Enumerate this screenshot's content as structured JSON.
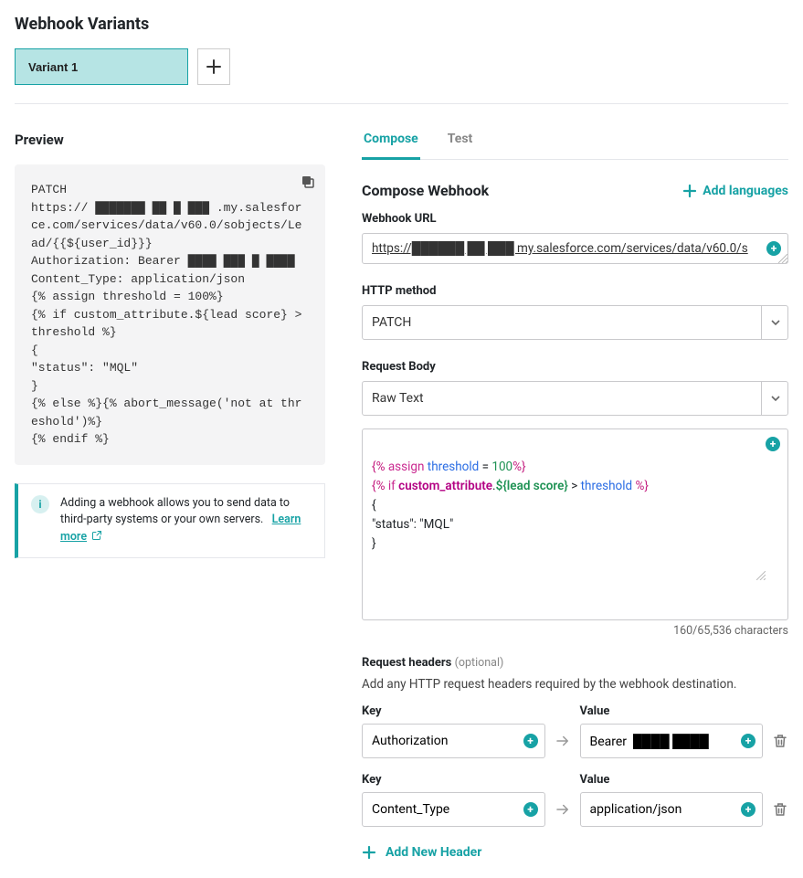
{
  "page_title": "Webhook Variants",
  "variant_tab": "Variant 1",
  "preview_label": "Preview",
  "preview_text": "PATCH\nhttps:// ███████ ██ █ ███ .my.salesforce.com/services/data/v60.0/sobjects/Lead/{{${user_id}}}\nAuthorization: Bearer ████ ███ █ ████\nContent_Type: application/json\n{% assign threshold = 100%}\n{% if custom_attribute.${lead score} > threshold %}\n{\n\"status\": \"MQL\"\n}\n{% else %}{% abort_message('not at threshold')%}\n{% endif %}",
  "info_text": "Adding a webhook allows you to send data to third-party systems or your own servers.",
  "learn_more": "Learn more",
  "tabs": {
    "compose": "Compose",
    "test": "Test"
  },
  "compose_title": "Compose Webhook",
  "add_languages": "Add languages",
  "url_label": "Webhook URL",
  "url_value": "https://██████ ██ ███ my.salesforce.com/services/data/v60.0/s",
  "method_label": "HTTP method",
  "method_value": "PATCH",
  "body_label": "Request Body",
  "body_type_value": "Raw Text",
  "body_code": {
    "line1_pre": "{% ",
    "line1_assign": "assign",
    "line1_mid1": " ",
    "line1_threshold": "threshold",
    "line1_mid2": " = ",
    "line1_num": "100",
    "line1_post": "%}",
    "line2_pre": "{% ",
    "line2_if": "if",
    "line2_mid1": " ",
    "line2_attr": "custom_attribute",
    "line2_dot": ".",
    "line2_param": "${lead score}",
    "line2_gt": " > ",
    "line2_thresh": "threshold",
    "line2_sp": " ",
    "line2_post": "%}",
    "line3": "{",
    "line4": "\"status\": \"MQL\"",
    "line5": "}"
  },
  "char_count": "160/65,536 characters",
  "req_headers_label": "Request headers",
  "optional_text": "(optional)",
  "req_headers_sub": "Add any HTTP request headers required by the webhook destination.",
  "key_label": "Key",
  "value_label": "Value",
  "headers": [
    {
      "key": "Authorization",
      "value": "Bearer  ████ ████"
    },
    {
      "key": "Content_Type",
      "value": "application/json"
    }
  ],
  "add_header_label": "Add New Header"
}
